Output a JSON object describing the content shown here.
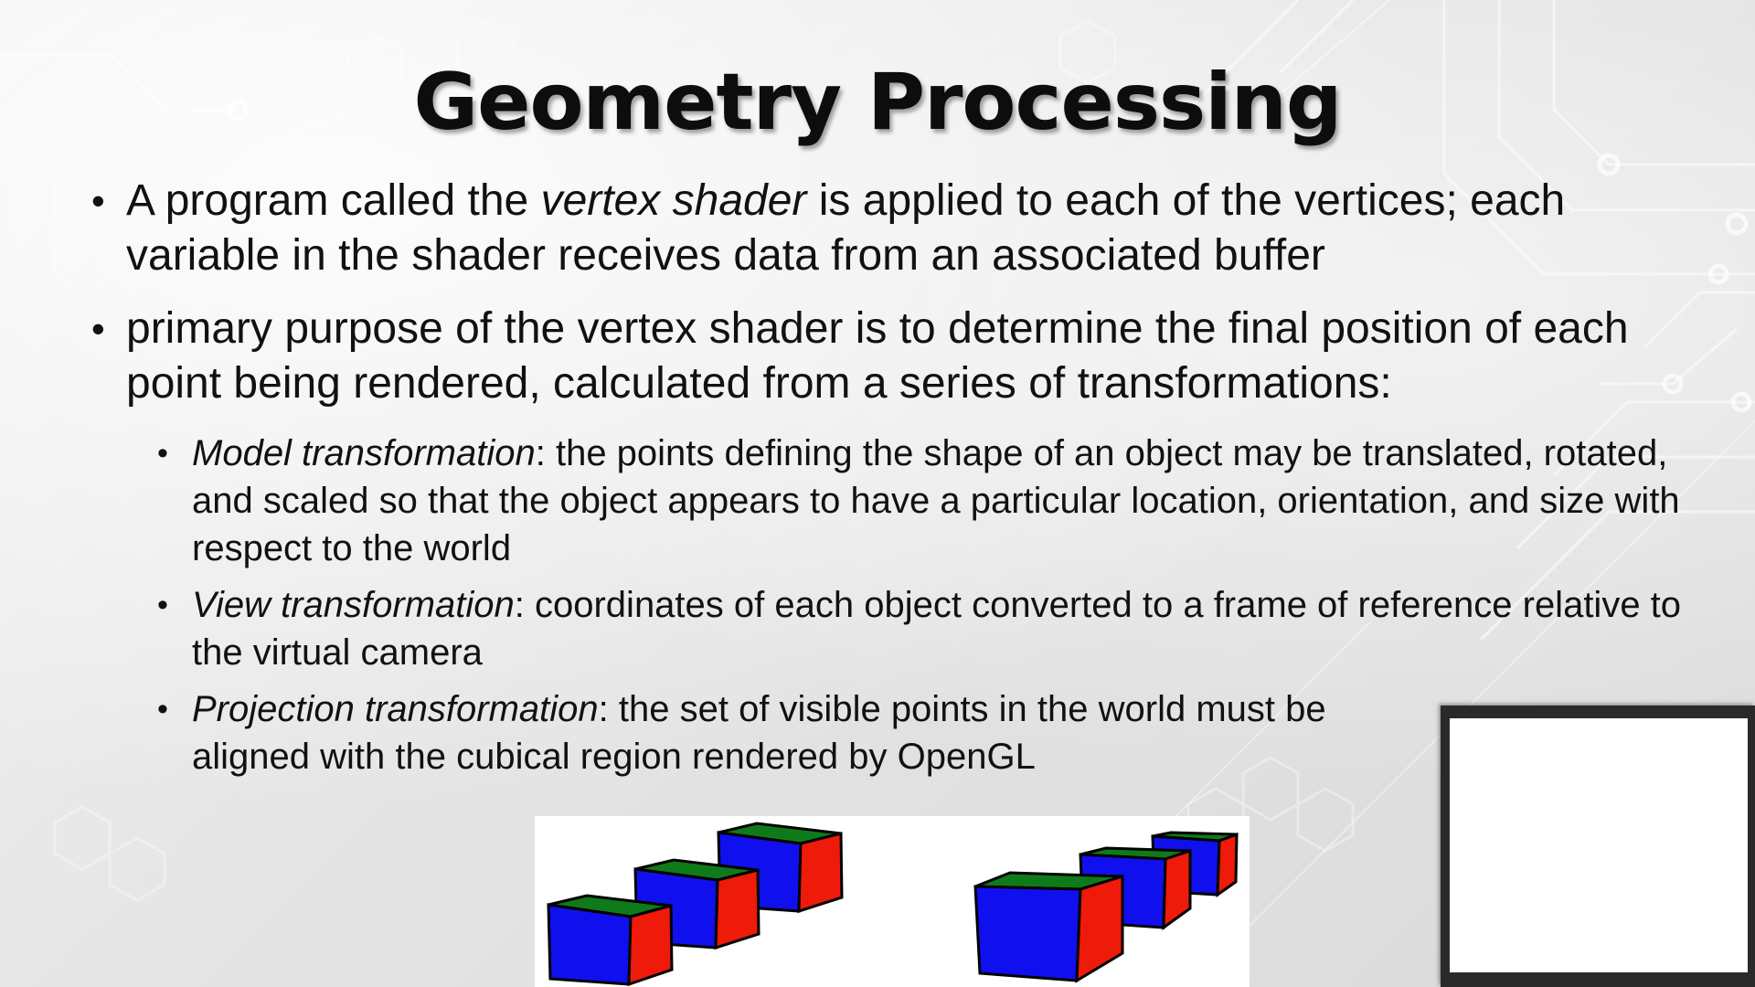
{
  "slide": {
    "title": "Geometry Processing",
    "bullets": [
      {
        "pre": "A program called the ",
        "em": "vertex shader",
        "post": " is applied to each of the vertices; each variable in the shader receives data from an associated buffer"
      },
      {
        "text": "primary purpose of the vertex shader is to determine the final position of each point being rendered, calculated from a series of transformations:"
      }
    ],
    "sub_bullets": [
      {
        "term": "Model transformation",
        "text": ": the points defining the shape of an object may be translated, rotated, and scaled so that the object appears to have a particular location, orientation, and size with respect to the world"
      },
      {
        "term": "View transformation",
        "text": ": coordinates of each object converted to a frame of reference relative to the virtual camera"
      },
      {
        "term": "Projection transformation",
        "text": ": the set of visible points in the world must be aligned with the cubical region rendered by OpenGL"
      }
    ],
    "bullet_glyph": "•"
  },
  "illustration": {
    "colors": {
      "front": "#1010ee",
      "side": "#ee1a0a",
      "top": "#0f7a1a",
      "edge": "#000000"
    }
  }
}
